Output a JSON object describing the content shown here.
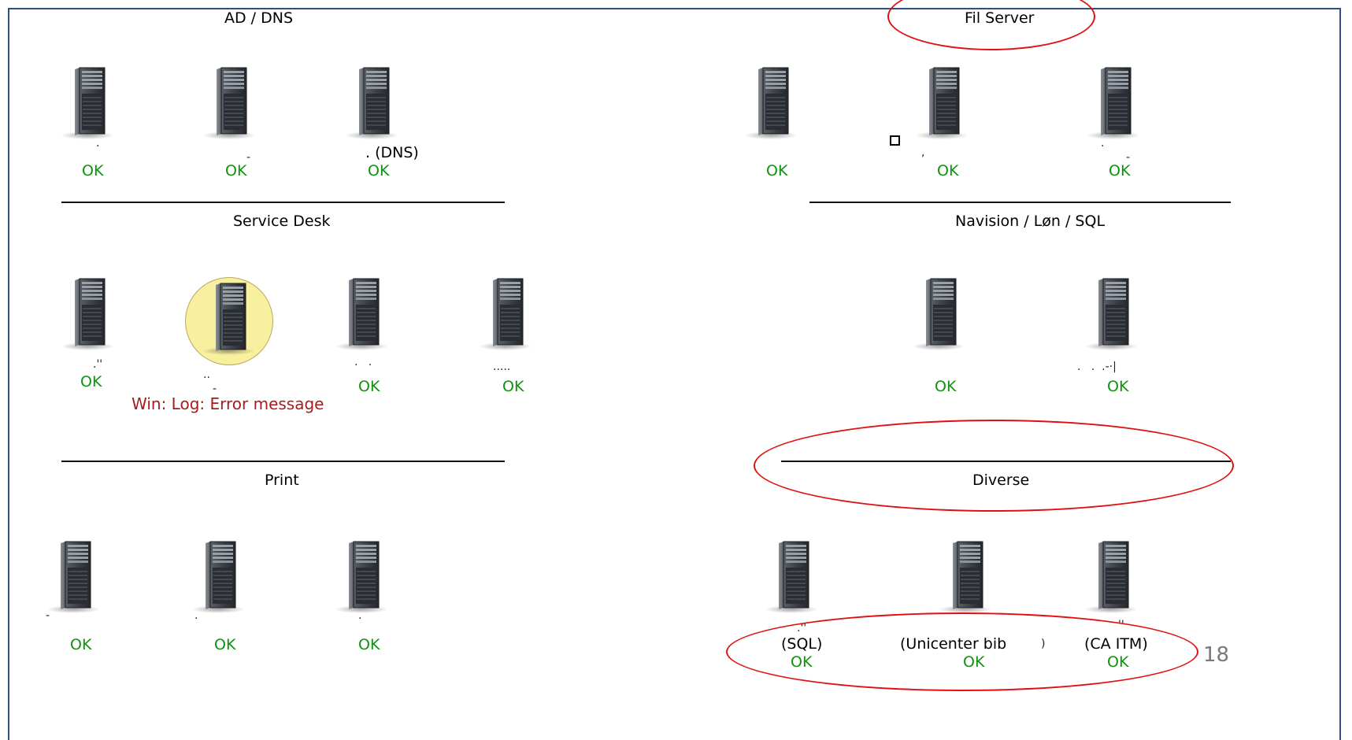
{
  "groups": {
    "ad_dns": {
      "title": "AD / DNS",
      "servers": [
        {
          "label": "",
          "status": "OK"
        },
        {
          "label": "",
          "status": "OK"
        },
        {
          "label": ". (DNS)",
          "status": "OK"
        }
      ]
    },
    "fil_server": {
      "title": "Fil Server",
      "servers": [
        {
          "label": "",
          "status": "OK"
        },
        {
          "label": "",
          "status": "OK"
        },
        {
          "label": "",
          "status": "OK"
        }
      ]
    },
    "service_desk": {
      "title": "Service Desk",
      "servers": [
        {
          "label": "",
          "status": "OK"
        },
        {
          "label": "",
          "status": "",
          "alert": "Win: Log: Error message"
        },
        {
          "label": "",
          "status": "OK"
        },
        {
          "label": "",
          "status": "OK"
        }
      ]
    },
    "navision": {
      "title": "Navision / Løn / SQL",
      "servers": [
        {
          "label": "",
          "status": "OK"
        },
        {
          "label": "",
          "status": "OK"
        }
      ]
    },
    "print": {
      "title": "Print",
      "servers": [
        {
          "label": "",
          "status": "OK"
        },
        {
          "label": "",
          "status": "OK"
        },
        {
          "label": "",
          "status": "OK"
        }
      ]
    },
    "diverse": {
      "title": "Diverse",
      "servers": [
        {
          "label": "(SQL)",
          "status": "OK"
        },
        {
          "label": "(Unicenter bib",
          "status": "OK"
        },
        {
          "label": "(CA ITM)",
          "status": "OK"
        }
      ]
    }
  },
  "slide": {
    "page_number": "18"
  },
  "colors": {
    "ok": "#119011",
    "error": "#a51d1d",
    "annotation": "#e01010",
    "frame": "#2d4f86",
    "highlight": "#f8ef9f"
  }
}
